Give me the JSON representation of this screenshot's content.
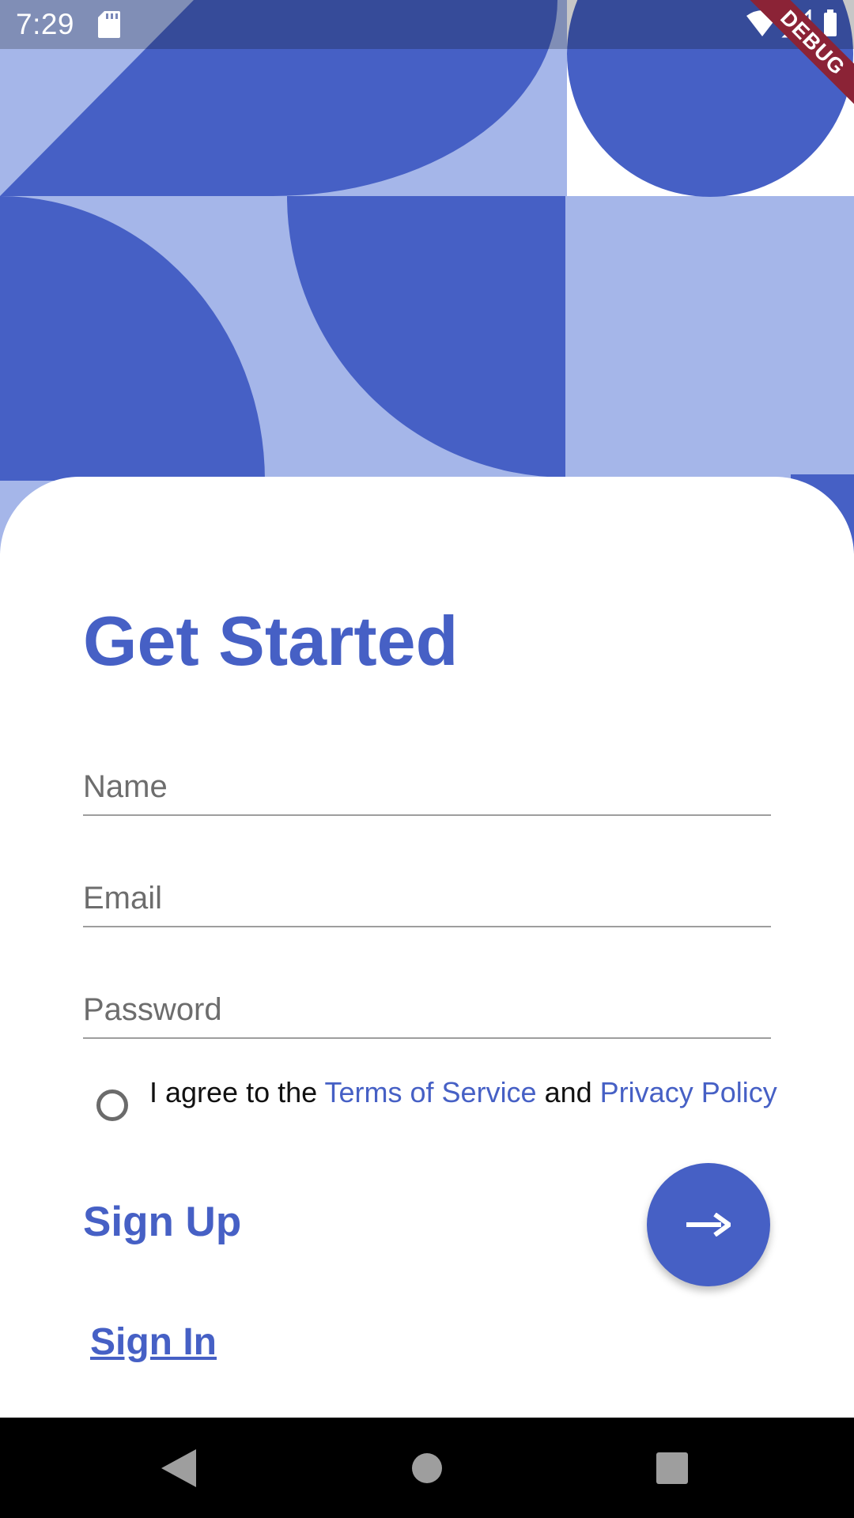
{
  "status_bar": {
    "time": "7:29",
    "icons": [
      "sd-card-icon",
      "wifi-icon",
      "cell-signal-icon",
      "battery-icon"
    ]
  },
  "debug_banner": {
    "label": "DEBUG"
  },
  "form": {
    "title": "Get Started",
    "name_placeholder": "Name",
    "email_placeholder": "Email",
    "password_placeholder": "Password",
    "agree": {
      "prefix": "I agree to the ",
      "terms_link": "Terms of Service",
      "middle": " and ",
      "privacy_link": "Privacy Policy",
      "checked": false
    },
    "signup_label": "Sign Up",
    "signin_link": "Sign In"
  },
  "nav_bar": {
    "buttons": [
      "back-icon",
      "home-icon",
      "recents-icon"
    ]
  },
  "colors": {
    "primary": "#4660c5",
    "light_blue": "#a5b6e9",
    "debug_ribbon": "#8b2336"
  }
}
